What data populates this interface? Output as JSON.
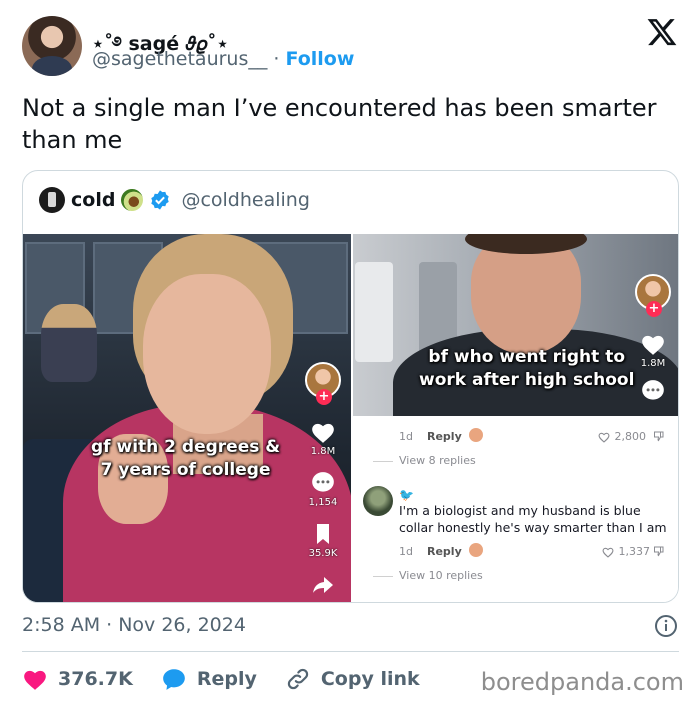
{
  "author": {
    "display_name": "⋆˚࿔ sagé 𝜗𝜚˚⋆",
    "handle": "@sagethetaurus__",
    "separator": "·",
    "follow_label": "Follow"
  },
  "tweet": {
    "text": "Not a single man I’ve encountered has been smarter than me",
    "timestamp": "2:58 AM · Nov 26, 2024"
  },
  "quoted": {
    "display_name": "cold",
    "handle": "@coldhealing",
    "left_video": {
      "caption_line1": "gf with 2 degrees &",
      "caption_line2": "7 years of college",
      "likes": "1.8M",
      "comments": "1,154",
      "saves": "35.9K"
    },
    "right_video": {
      "caption_line1": "bf who went right to",
      "caption_line2": "work after high school",
      "likes": "1.8M"
    },
    "comments": {
      "first": {
        "time": "1d",
        "reply_label": "Reply",
        "likes": "2,800",
        "view_replies": "View 8 replies"
      },
      "second": {
        "text": "I'm a biologist and my husband is blue collar honestly he's way smarter than I am",
        "time": "1d",
        "reply_label": "Reply",
        "likes": "1,337",
        "view_replies": "View 10 replies"
      }
    }
  },
  "actions": {
    "like_count": "376.7K",
    "reply_label": "Reply",
    "copy_link_label": "Copy link"
  },
  "watermark": "boredpanda.com",
  "colors": {
    "accent": "#1d9bf0",
    "like": "#f91880",
    "muted": "#536471"
  }
}
